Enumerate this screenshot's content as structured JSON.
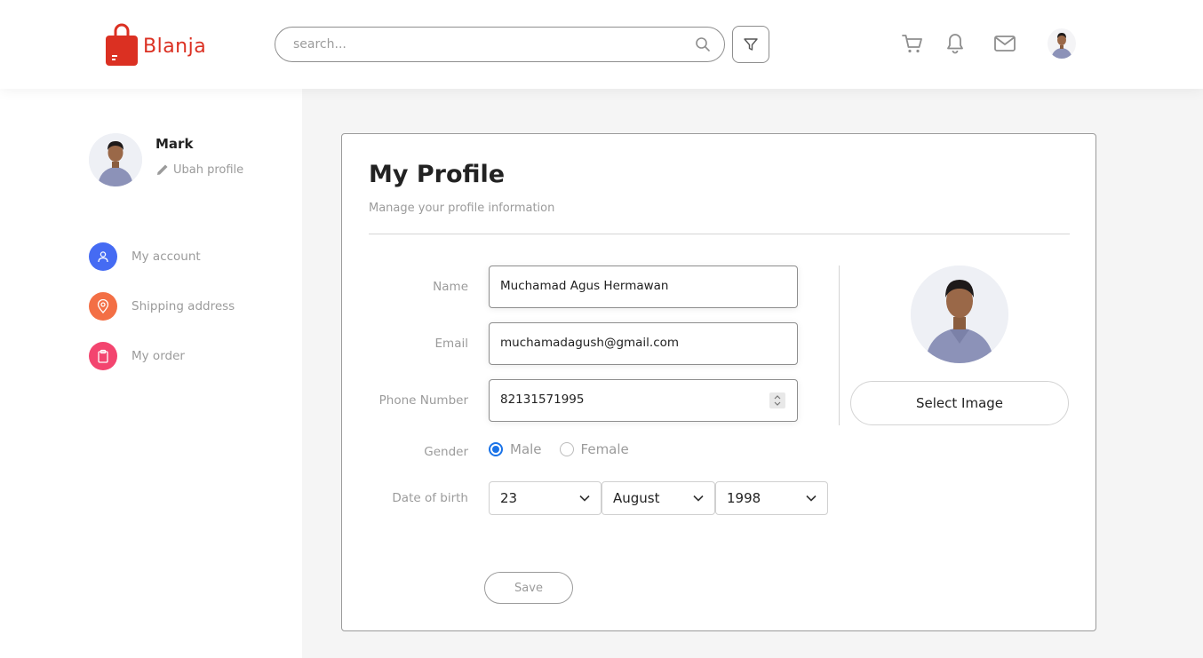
{
  "brand": {
    "name": "Blanja",
    "color": "#db3022"
  },
  "header": {
    "search_placeholder": "search...",
    "icons": [
      "search-icon",
      "filter-icon",
      "cart-icon",
      "bell-icon",
      "mail-icon"
    ]
  },
  "sidebar": {
    "user_name": "Mark",
    "edit_label": "Ubah profile",
    "items": [
      {
        "label": "My account",
        "icon": "user-icon",
        "color": "#456bf3"
      },
      {
        "label": "Shipping address",
        "icon": "map-pin-icon",
        "color": "#f36f45"
      },
      {
        "label": "My order",
        "icon": "clipboard-icon",
        "color": "#f3456f"
      }
    ]
  },
  "profile": {
    "title": "My Profile",
    "subtitle": "Manage your profile information",
    "fields": {
      "name_label": "Name",
      "name_value": "Muchamad Agus Hermawan",
      "email_label": "Email",
      "email_value": "muchamadagush@gmail.com",
      "phone_label": "Phone Number",
      "phone_value": "82131571995",
      "gender_label": "Gender",
      "gender_options": [
        "Male",
        "Female"
      ],
      "gender_selected": "Male",
      "dob_label": "Date of birth",
      "dob_day": "23",
      "dob_month": "August",
      "dob_year": "1998"
    },
    "save_label": "Save",
    "select_image_label": "Select Image"
  },
  "colors": {
    "accent": "#1a73e8",
    "muted": "#9b9b9b"
  }
}
